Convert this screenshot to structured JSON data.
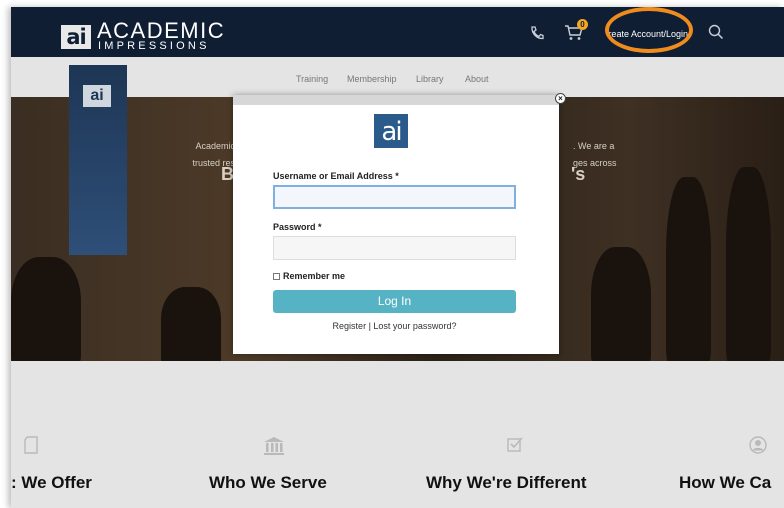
{
  "header": {
    "logo_mark": "ai",
    "logo_word1": "ACADEMIC",
    "logo_word2": "IMPRESSIONS",
    "cart_count": "0",
    "account_link": "Create Account/Login"
  },
  "nav": {
    "items": [
      "Training",
      "Membership",
      "Library",
      "About"
    ]
  },
  "hero": {
    "banner_logo": "ai",
    "big_left": "B",
    "big_right": "'s",
    "text_left": [
      "Academic",
      "trusted res"
    ],
    "text_right": [
      ". We are a",
      "ges across"
    ]
  },
  "modal": {
    "logo": "ai",
    "close": "×",
    "username_label": "Username or Email Address *",
    "username_value": "",
    "password_label": "Password *",
    "password_value": "",
    "remember_label": "Remember me",
    "login_button": "Log In",
    "register_link": "Register",
    "separator": " | ",
    "lost_password_link": "Lost your password?"
  },
  "features": [
    {
      "title": ": We Offer",
      "icon": "document-icon"
    },
    {
      "title": "Who We Serve",
      "icon": "institution-icon"
    },
    {
      "title": "Why We're Different",
      "icon": "checklist-icon"
    },
    {
      "title": "How We Ca",
      "icon": "person-icon"
    }
  ]
}
